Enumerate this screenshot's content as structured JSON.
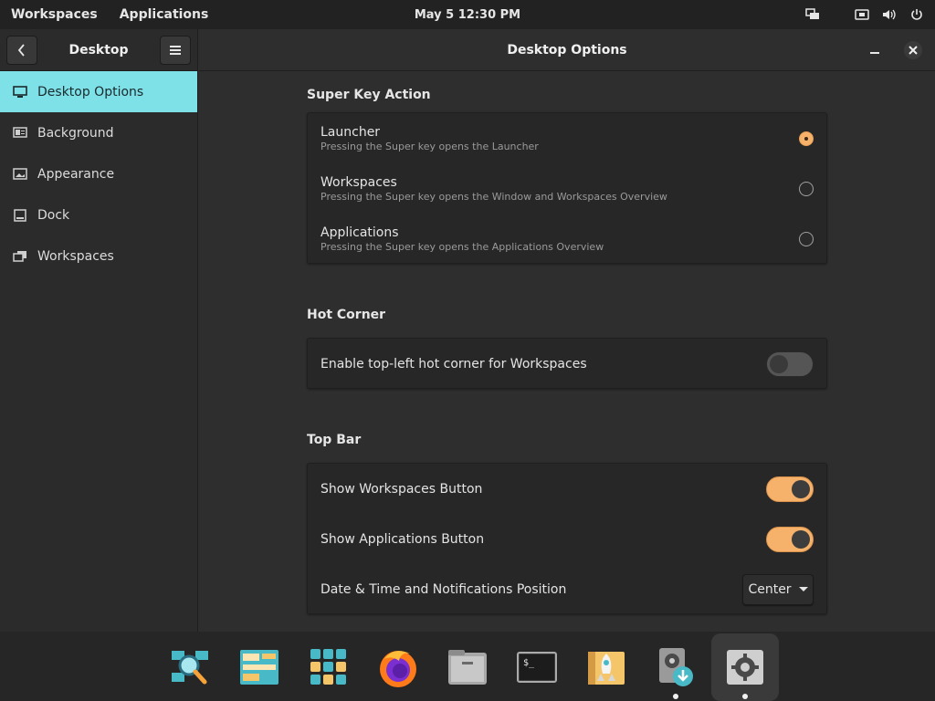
{
  "topbar": {
    "workspaces": "Workspaces",
    "applications": "Applications",
    "datetime": "May 5  12:30 PM",
    "icons": [
      "display-icon",
      "network-icon",
      "volume-icon",
      "power-icon"
    ]
  },
  "sidebar": {
    "title": "Desktop",
    "items": [
      {
        "label": "Desktop Options",
        "icon": "monitor-icon",
        "active": true
      },
      {
        "label": "Background",
        "icon": "background-icon"
      },
      {
        "label": "Appearance",
        "icon": "appearance-icon"
      },
      {
        "label": "Dock",
        "icon": "dock-icon"
      },
      {
        "label": "Workspaces",
        "icon": "workspaces-icon"
      }
    ]
  },
  "main": {
    "title": "Desktop Options",
    "super_key": {
      "title": "Super Key Action",
      "options": [
        {
          "label": "Launcher",
          "desc": "Pressing the Super key opens the Launcher",
          "checked": true
        },
        {
          "label": "Workspaces",
          "desc": "Pressing the Super key opens the Window and Workspaces Overview",
          "checked": false
        },
        {
          "label": "Applications",
          "desc": "Pressing the Super key opens the Applications Overview",
          "checked": false
        }
      ]
    },
    "hot_corner": {
      "title": "Hot Corner",
      "label": "Enable top-left hot corner for Workspaces",
      "enabled": false
    },
    "top_bar": {
      "title": "Top Bar",
      "workspaces_button": {
        "label": "Show Workspaces Button",
        "enabled": true
      },
      "applications_button": {
        "label": "Show Applications Button",
        "enabled": true
      },
      "position": {
        "label": "Date & Time and Notifications Position",
        "value": "Center"
      }
    }
  },
  "dock": {
    "apps": [
      "search-app-icon",
      "files-layout-app-icon",
      "app-grid-icon",
      "firefox-icon",
      "file-manager-icon",
      "terminal-icon",
      "launch-app-icon",
      "installer-app-icon",
      "settings-app-icon"
    ],
    "running": [
      "installer-app-icon",
      "settings-app-icon"
    ],
    "focused": "settings-app-icon"
  },
  "colors": {
    "accent": "#f6b26b",
    "sidebar_active": "#7fe1e8",
    "background": "#2e2e2e"
  }
}
